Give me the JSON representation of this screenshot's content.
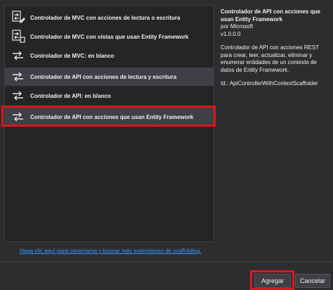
{
  "templates": [
    {
      "label": "Controlador de MVC con acciones de lectura o escritura",
      "icon": "controller-read-write-icon"
    },
    {
      "label": "Controlador de MVC con vistas que usan Entity Framework",
      "icon": "controller-views-icon"
    },
    {
      "label": "Controlador de MVC: en blanco",
      "icon": "controller-icon"
    },
    {
      "label": "Controlador de API con acciones de lectura y escritura",
      "icon": "controller-icon"
    },
    {
      "label": "Controlador de API: en blanco",
      "icon": "controller-icon"
    },
    {
      "label": "Controlador de API con acciones que usan Entity Framework",
      "icon": "controller-icon"
    }
  ],
  "details": {
    "title": "Controlador de API con acciones que usan Entity Framework",
    "author": "por Microsoft",
    "version": "v1.0.0.0",
    "description": "Controlador de API con acciones REST para crear, leer, actualizar, eliminar y enumerar entidades de un contexto de datos de Entity Framework.",
    "id": "Id.: ApiControllerWithContextScaffolder"
  },
  "link_text": "Haga clic aquí para conectarse y buscar más extensiones de scaffolding.",
  "buttons": {
    "add": "Agregar",
    "cancel": "Cancelar"
  },
  "colors": {
    "highlight": "#e0161b",
    "link": "#3399ff",
    "background": "#2d2d30"
  }
}
